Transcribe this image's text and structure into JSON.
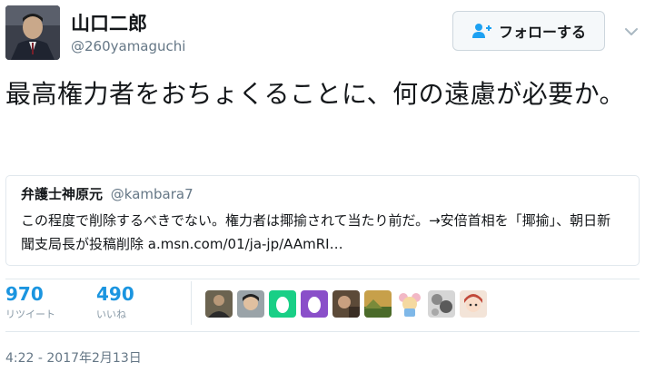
{
  "author": {
    "display_name": "山口二郎",
    "handle": "@260yamaguchi",
    "avatar_icon": "profile-photo-man-in-suit"
  },
  "follow_button": {
    "label": "フォローする",
    "icon": "add-user-icon",
    "accent": "#1da1f2"
  },
  "tweet": {
    "text": "最高権力者をおちょくることに、何の遠慮が必要か。"
  },
  "quoted_tweet": {
    "display_name": "弁護士神原元",
    "handle": "@kambara7",
    "text": "この程度で削除するべきでない。権力者は揶揄されて当たり前だ。→安倍首相を「揶揄」、朝日新聞支局長が投稿削除 a.msn.com/01/ja-jp/AAmRI…"
  },
  "stats": {
    "retweets": {
      "count": "970",
      "label": "リツイート"
    },
    "likes": {
      "count": "490",
      "label": "いいね"
    }
  },
  "likers": [
    {
      "icon": "avatar-person-dark"
    },
    {
      "icon": "avatar-person-face"
    },
    {
      "icon": "avatar-egg-green",
      "color": "#19cf86"
    },
    {
      "icon": "avatar-egg-purple",
      "color": "#8a4fc9"
    },
    {
      "icon": "avatar-person-photo"
    },
    {
      "icon": "avatar-landscape-photo"
    },
    {
      "icon": "avatar-cartoon-mouse"
    },
    {
      "icon": "avatar-abstract-pattern"
    },
    {
      "icon": "avatar-anime-character"
    }
  ],
  "timestamp": "4:22 - 2017年2月13日",
  "colors": {
    "link": "#1b95e0",
    "secondary_text": "#657786",
    "border": "#e1e8ed"
  }
}
